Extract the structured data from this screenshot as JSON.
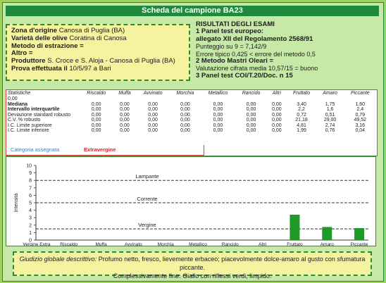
{
  "header": {
    "title": "Scheda del campione BA23"
  },
  "origin": {
    "zona_label": "Zona d'origine",
    "zona_value": "Canosa di Puglia (BA)",
    "varieta_label": "Varietà delle olive",
    "varieta_value": "Coratina di Canosa",
    "metodo_label": "Metodo di estrazione",
    "metodo_value": "=",
    "altro_label": "Altro",
    "altro_value": "=",
    "produttore_label": "Produttore",
    "produttore_value": "S. Croce e S. Aloja - Canosa di Puglia (BA)",
    "prova_label": "Prova effettuata il",
    "prova_value": "10/5/97  a Bari"
  },
  "results": {
    "heading": "RISULTATI DEGLI ESAMI",
    "line1": "1 Panel test europeo:",
    "line2": "allegato XII del Regolamento 2568/91",
    "line3": "Punteggio su 9 = 7,142/9",
    "line4": "Errore tipico 0,425 < errore del metodo 0,5",
    "line5": "2 Metodo Mastri Oleari =",
    "line6": "Valutazione cifrata media 10,57/15 = buono",
    "line7": "3 Panel test COI/T.20/Doc. n 15"
  },
  "table": {
    "headers": [
      "Statistiche",
      "Riscaldo",
      "Muffa",
      "Avvinato",
      "Morchia",
      "Metallico",
      "Rancido",
      "Altri",
      "Fruttato",
      "Amaro",
      "Piccante"
    ],
    "zero_row": "0,00",
    "rows": [
      {
        "label": "Mediana",
        "values": [
          "0,00",
          "0,00",
          "0,00",
          "0,00",
          "0,00",
          "0,00",
          "0,00",
          "3,40",
          "1,75",
          "1,60"
        ]
      },
      {
        "label": "Intervallo interquartile",
        "values": [
          "0,00",
          "0,00",
          "0,00",
          "0,00",
          "0,00",
          "0,00",
          "0,00",
          "2,2",
          "1,6",
          "2,4"
        ]
      },
      {
        "label": "Deviazione standard robusto",
        "values": [
          "0,00",
          "0,00",
          "0,00",
          "0,00",
          "0,00",
          "0,00",
          "0,00",
          "0,72",
          "0,51",
          "0,79"
        ]
      },
      {
        "label": "C.V. % robusto",
        "values": [
          "0,00",
          "0,00",
          "0,00",
          "0,00",
          "0,00",
          "0,00",
          "0,00",
          "21,18",
          "29,00",
          "49,52"
        ]
      },
      {
        "label": "I.C. Limite superiore",
        "values": [
          "0,00",
          "0,00",
          "0,00",
          "0,00",
          "0,00",
          "0,00",
          "0,00",
          "4,81",
          "2,74",
          "3,16"
        ]
      },
      {
        "label": "I.C. Limite inferiore",
        "values": [
          "0,00",
          "0,00",
          "0,00",
          "0,00",
          "0,00",
          "0,00",
          "0,00",
          "1,99",
          "0,76",
          "0,04"
        ]
      }
    ],
    "category_label": "Categoria assegnata",
    "category_value": "Extravergine"
  },
  "chart_data": {
    "type": "bar",
    "categories": [
      "Vergine Extra",
      "Riscaldo",
      "Muffa",
      "Avvinato",
      "Morchia",
      "Metallico",
      "Rancido",
      "Altri",
      "Fruttato",
      "Amaro",
      "Piccante"
    ],
    "values": [
      null,
      0,
      0,
      0,
      0,
      0,
      0,
      0,
      3.4,
      1.75,
      1.6
    ],
    "ylabel": "Intensità",
    "ylim": [
      0,
      10
    ],
    "yticks": [
      "0",
      "1",
      "2",
      "3",
      "4",
      "5",
      "6",
      "7",
      "8",
      "9",
      "10"
    ],
    "bands": [
      {
        "label": "Lampante",
        "y": 8
      },
      {
        "label": "Corrente",
        "y": 5
      },
      {
        "label": "Vergine",
        "y": 1.5
      }
    ],
    "bar_color": "#1f9a2a"
  },
  "comment": {
    "label": "Giudizio globale descrittivo:",
    "text1": "Profumo netto, fresco, lievemente erbaceo; piacevolmente dolce-amaro al gusto con sfumatura piccante.",
    "text2": "Complessivamente fine. Giallo con riflessi verdi, limpido."
  }
}
